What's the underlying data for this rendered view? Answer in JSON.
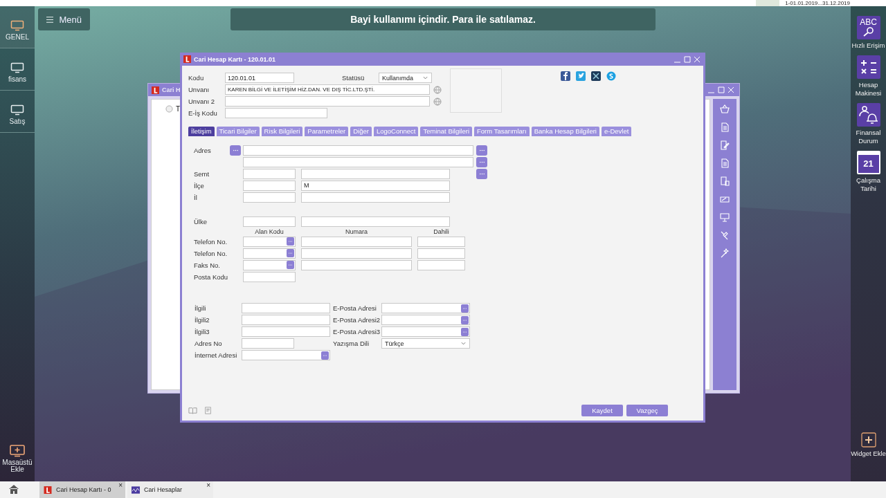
{
  "top_bar": {
    "period": "1-01.01.2019...31.12.2019"
  },
  "left_sidebar": {
    "items": [
      {
        "label": "GENEL",
        "selected": true
      },
      {
        "label": "fisans",
        "selected": false
      },
      {
        "label": "Satış",
        "selected": false
      }
    ],
    "add_button": "Masaüstü Ekle"
  },
  "menu_button": "Menü",
  "banner": "Bayi kullanımı içindir. Para ile satılamaz.",
  "back_window": {
    "title": "Cari H",
    "tree_item": "T"
  },
  "window": {
    "title": "Cari Hesap Kartı - 120.01.01",
    "code": {
      "label": "Kodu",
      "value": "120.01.01"
    },
    "status": {
      "label": "Statüsü",
      "value": "Kullanımda"
    },
    "title_field": {
      "label": "Unvanı",
      "value": "KAREN BİLGİ VE İLETİŞİM HİZ.DAN. VE DIŞ TİC.LTD.ŞTİ."
    },
    "title_2": {
      "label": "Unvanı 2"
    },
    "e_is_code": {
      "label": "E-İş Kodu"
    },
    "tabs": [
      {
        "label": "İletişim",
        "selected": true
      },
      {
        "label": "Ticari Bilgiler",
        "selected": false
      },
      {
        "label": "Risk Bilgileri",
        "selected": false
      },
      {
        "label": "Parametreler",
        "selected": false
      },
      {
        "label": "Diğer",
        "selected": false
      },
      {
        "label": "LogoConnect",
        "selected": false
      },
      {
        "label": "Teminat Bilgileri",
        "selected": false
      },
      {
        "label": "Form Tasarımları",
        "selected": false
      },
      {
        "label": "Banka Hesap Bilgileri",
        "selected": false
      },
      {
        "label": "e-Devlet",
        "selected": false
      }
    ],
    "address_label": "Adres",
    "location_rows": [
      {
        "label": "Semt"
      },
      {
        "label": "İlçe",
        "value": "M"
      },
      {
        "label": "İl"
      }
    ],
    "country_label": "Ülke",
    "phone_columns": [
      "Alan Kodu",
      "Numara",
      "Dahili"
    ],
    "phone_rows": [
      {
        "label": "Telefon No."
      },
      {
        "label": "Telefon No."
      },
      {
        "label": "Faks No."
      }
    ],
    "postal_label": "Posta Kodu",
    "contacts": [
      {
        "label": "İlgili"
      },
      {
        "label": "İlgili2"
      },
      {
        "label": "İlgili3"
      }
    ],
    "emails": [
      {
        "label": "E-Posta Adresi"
      },
      {
        "label": "E-Posta Adresi2"
      },
      {
        "label": "E-Posta Adresi3"
      }
    ],
    "address_no_label": "Adres No",
    "internet_label": "İnternet Adresi",
    "language": {
      "label": "Yazışma Dili",
      "value": "Türkçe"
    },
    "buttons": [
      "Kaydet",
      "Vazgeç"
    ]
  },
  "right_sidebar": {
    "items": [
      {
        "kind": "search",
        "icon_text": "ABC",
        "label": "Hızlı Erişim"
      },
      {
        "kind": "calculator",
        "label": "Hesap Makinesi"
      },
      {
        "kind": "person-bell",
        "label": "Finansal Durum"
      },
      {
        "kind": "calendar",
        "icon_text": "21",
        "label": "Çalışma Tarihi"
      }
    ],
    "add_button": "Widget Ekle"
  },
  "taskbar": {
    "tabs": [
      {
        "label": "Cari Hesap Kartı - 0",
        "selected": true,
        "close": "×"
      },
      {
        "label": "Cari Hesaplar",
        "selected": false,
        "close": "×"
      }
    ]
  }
}
